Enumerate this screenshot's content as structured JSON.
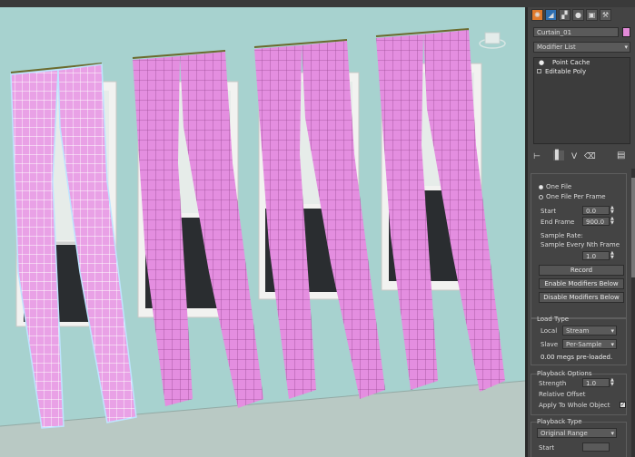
{
  "panel": {
    "object_name": "Curtain_01",
    "object_color": "#e28ad8",
    "modifier_list_label": "Modifier List",
    "stack": [
      {
        "label": "Point Cache",
        "selected": false
      },
      {
        "label": "Editable Poly",
        "selected": true
      }
    ],
    "point_cache": {
      "one_file": "One File",
      "one_file_per_frame": "One File Per Frame",
      "start_label": "Start",
      "start_value": "0.0",
      "end_label": "End Frame",
      "end_value": "900.0",
      "sample_rate_label": "Sample Rate:",
      "sample_every_label": "Sample Every Nth Frame",
      "sample_value": "1.0",
      "record_button": "Record",
      "enable_button": "Enable Modifiers Below",
      "disable_button": "Disable Modifiers Below"
    },
    "load_type": {
      "title": "Load Type",
      "local_label": "Local",
      "local_value": "Stream",
      "slave_label": "Slave",
      "slave_value": "Per-Sample",
      "preloaded": "0.00 megs pre-loaded."
    },
    "playback_options": {
      "title": "Playback Options",
      "strength_label": "Strength",
      "strength_value": "1.0",
      "relative_offset": "Relative Offset",
      "apply_whole": "Apply To Whole Object"
    },
    "playback_type": {
      "title": "Playback Type",
      "value": "Original Range",
      "start_label": "Start"
    }
  },
  "colors": {
    "viewport_bg": "#a7d2cf",
    "curtain_pink": "#e48ee0",
    "selection_outline": "#bfe4ff"
  }
}
